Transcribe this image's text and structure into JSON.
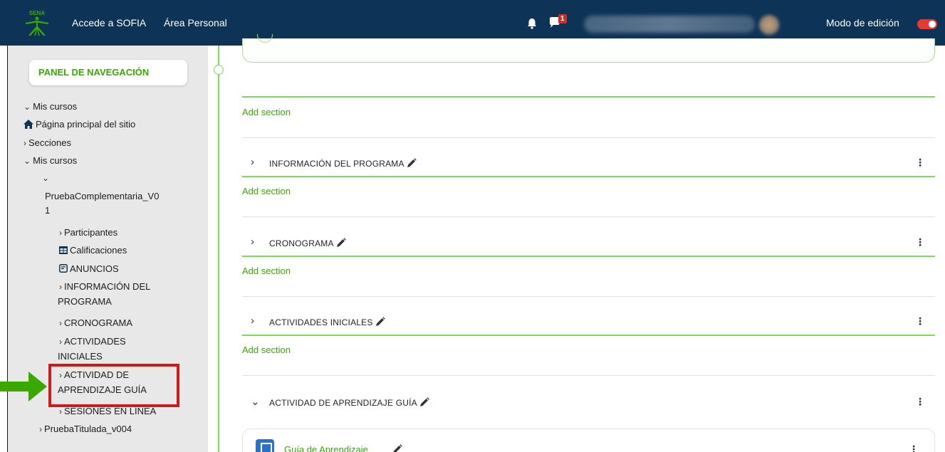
{
  "topbar": {
    "sofia_link": "Accede a SOFIA",
    "personal_area_link": "Área Personal",
    "messages_badge": "1",
    "edit_mode_label": "Modo de edición",
    "edit_mode_on": true,
    "background_color": "#0d3456",
    "toggle_color": "#e93a2e"
  },
  "sidebar": {
    "panel_title": "PANEL DE NAVEGACIÓN",
    "items": [
      {
        "label": "Mis cursos",
        "icon": "chevron-down-icon"
      },
      {
        "label": "Página principal del sitio",
        "icon": "home-icon"
      },
      {
        "label": "Secciones",
        "icon": "chevron-right-icon"
      },
      {
        "label": "Mis cursos",
        "icon": "chevron-down-icon"
      },
      {
        "label": "PruebaComplementaria_V0",
        "icon": "chevron-down-icon"
      },
      {
        "label": "1",
        "icon": ""
      },
      {
        "label": "Participantes",
        "icon": "chevron-right-icon"
      },
      {
        "label": "Calificaciones",
        "icon": "grades-table-icon"
      },
      {
        "label": "ANUNCIOS",
        "icon": "forum-icon"
      },
      {
        "label": "INFORMACIÓN DEL",
        "icon": "chevron-right-icon"
      },
      {
        "label": "PROGRAMA",
        "icon": ""
      },
      {
        "label": "CRONOGRAMA",
        "icon": "chevron-right-icon"
      },
      {
        "label": "ACTIVIDADES",
        "icon": "chevron-right-icon"
      },
      {
        "label": "INICIALES",
        "icon": ""
      },
      {
        "label": "ACTIVIDAD DE",
        "icon": "chevron-right-icon"
      },
      {
        "label": "APRENDIZAJE GUÍA",
        "icon": ""
      },
      {
        "label": "SESIONES EN LÍNEA",
        "icon": "chevron-right-icon"
      },
      {
        "label": "PruebaTitulada_v004",
        "icon": "chevron-right-icon"
      }
    ],
    "highlight_color": "#cf1a1a",
    "arrow_color": "#39a900"
  },
  "main": {
    "add_section_label": "Add section",
    "sections": [
      {
        "title": "INFORMACIÓN DEL PROGRAMA",
        "expanded": false
      },
      {
        "title": "CRONOGRAMA",
        "expanded": false
      },
      {
        "title": "ACTIVIDADES INICIALES",
        "expanded": false
      },
      {
        "title": "ACTIVIDAD DE APRENDIZAJE GUÍA",
        "expanded": true
      }
    ],
    "activity": {
      "title": "Guía de Aprendizaje"
    },
    "accent_color": "#39a900",
    "timeline_color": "#7ed957"
  }
}
